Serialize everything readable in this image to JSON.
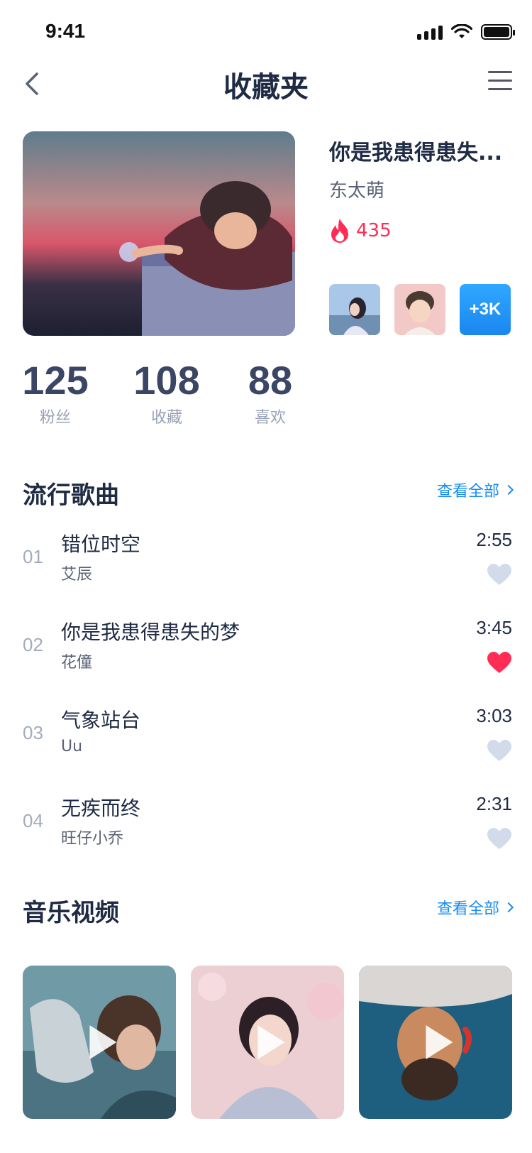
{
  "status_bar": {
    "time": "9:41"
  },
  "nav": {
    "title": "收藏夹"
  },
  "album": {
    "title": "你是我患得患失...",
    "artist": "东太萌",
    "hot_count": "435",
    "more_label": "+3K"
  },
  "stats": [
    {
      "value": "125",
      "label": "粉丝"
    },
    {
      "value": "108",
      "label": "收藏"
    },
    {
      "value": "88",
      "label": "喜欢"
    }
  ],
  "popular_songs": {
    "title": "流行歌曲",
    "see_all": "查看全部",
    "items": [
      {
        "index": "01",
        "title": "错位时空",
        "artist": "艾辰",
        "duration": "2:55",
        "liked": false
      },
      {
        "index": "02",
        "title": "你是我患得患失的梦",
        "artist": "花僮",
        "duration": "3:45",
        "liked": true
      },
      {
        "index": "03",
        "title": "气象站台",
        "artist": "Uu",
        "duration": "3:03",
        "liked": false
      },
      {
        "index": "04",
        "title": "无疾而终",
        "artist": "旺仔小乔",
        "duration": "2:31",
        "liked": false
      }
    ]
  },
  "music_videos": {
    "title": "音乐视频",
    "see_all": "查看全部"
  },
  "colors": {
    "accent_blue": "#1a8cf0",
    "hot_red": "#ff2d55",
    "heart_inactive": "#d3dbea",
    "text_primary": "#1f2a44"
  }
}
